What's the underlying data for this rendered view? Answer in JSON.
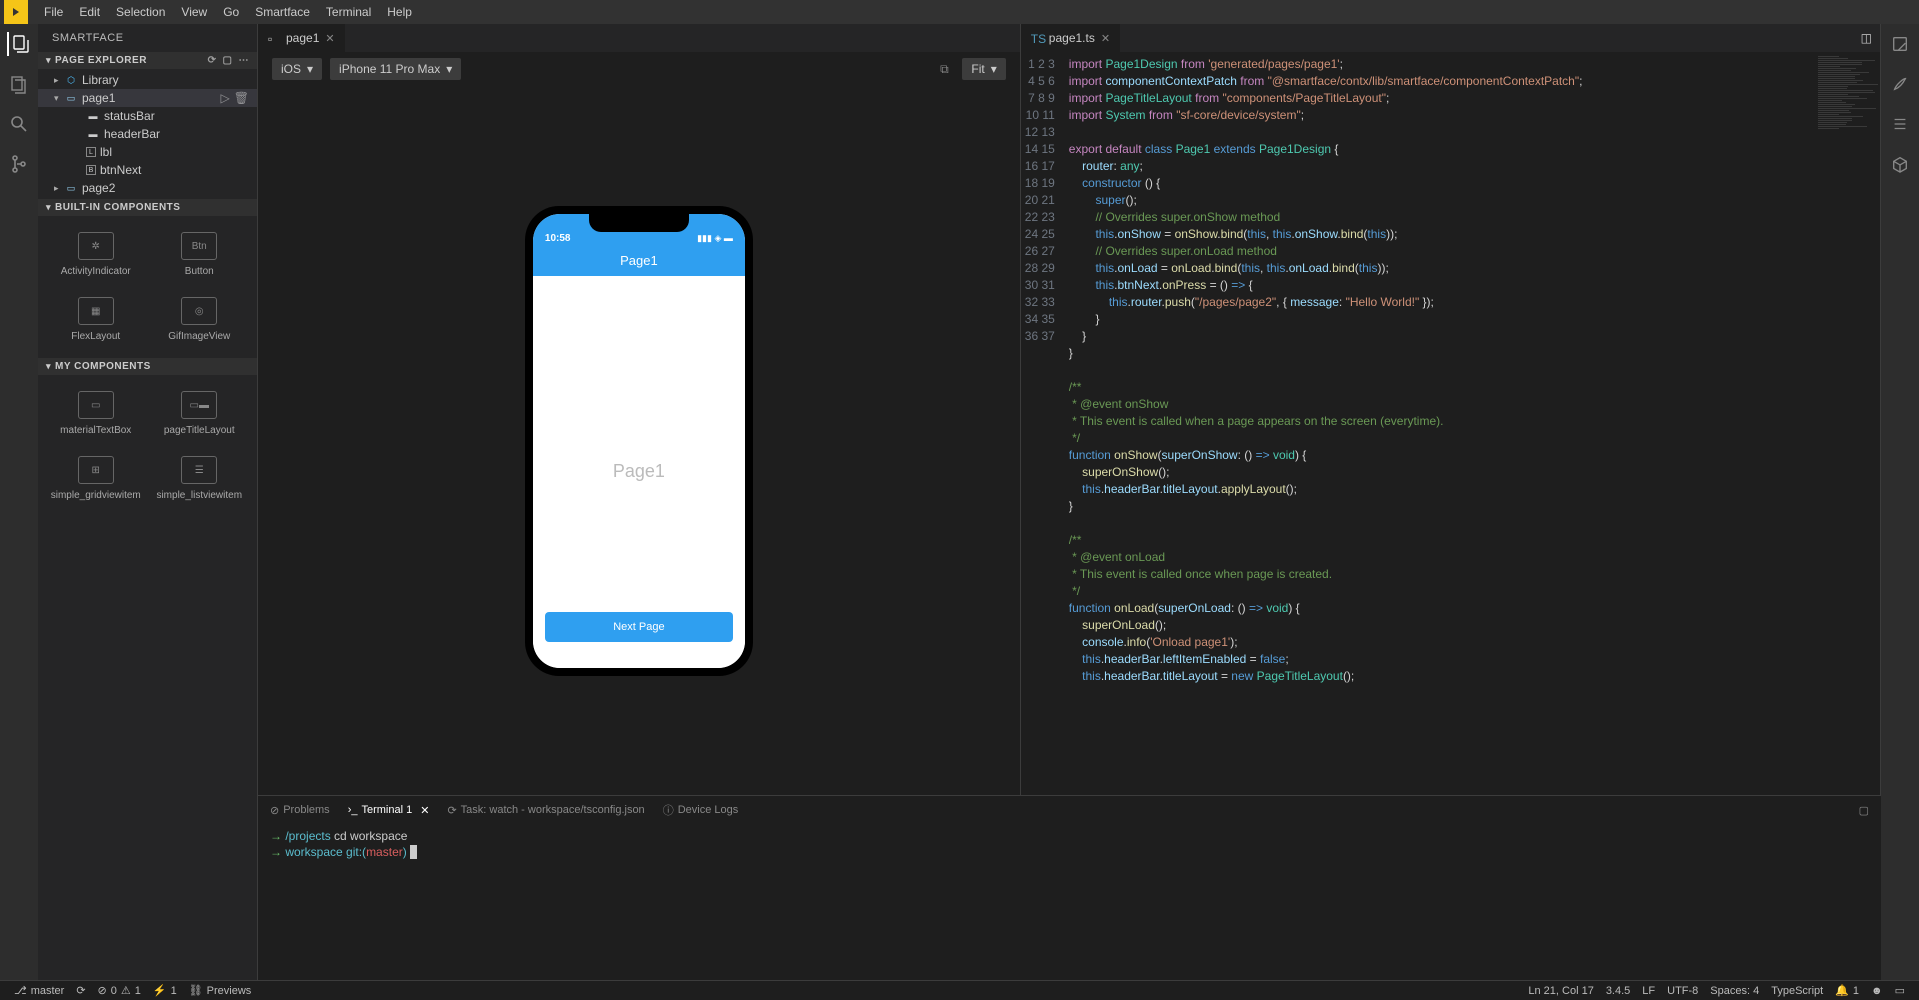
{
  "menu": [
    "File",
    "Edit",
    "Selection",
    "View",
    "Go",
    "Smartface",
    "Terminal",
    "Help"
  ],
  "sidebar_title": "SMARTFACE",
  "section_page_explorer": "PAGE EXPLORER",
  "section_builtin": "BUILT-IN COMPONENTS",
  "section_my": "MY COMPONENTS",
  "tree": {
    "library": "Library",
    "page1": "page1",
    "statusBar": "statusBar",
    "headerBar": "headerBar",
    "lbl": "lbl",
    "btnNext": "btnNext",
    "page2": "page2"
  },
  "builtin": [
    "ActivityIndicator",
    "Button",
    "FlexLayout",
    "GifImageView"
  ],
  "builtin_btn_label": "Btn",
  "my_components": [
    "materialTextBox",
    "pageTitleLayout",
    "simple_gridviewitem",
    "simple_listviewitem"
  ],
  "tabs": {
    "left": "page1",
    "right": "page1.ts"
  },
  "designer": {
    "platform": "iOS",
    "device": "iPhone 11 Pro Max",
    "zoom": "Fit",
    "time": "10:58",
    "header_title": "Page1",
    "body_label": "Page1",
    "btn_label": "Next Page"
  },
  "code_lines": [
    {
      "n": 1,
      "html": "<span class='k-purple'>import</span> <span class='k-teal'>Page1Design</span> <span class='k-purple'>from</span> <span class='k-str'>'generated/pages/page1'</span>;"
    },
    {
      "n": 2,
      "html": "<span class='k-purple'>import</span> <span class='k-lightblue'>componentContextPatch</span> <span class='k-purple'>from</span> <span class='k-str'>\"@smartface/contx/lib/smartface/componentContextPatch\"</span>;"
    },
    {
      "n": 3,
      "html": "<span class='k-purple'>import</span> <span class='k-teal'>PageTitleLayout</span> <span class='k-purple'>from</span> <span class='k-str'>\"components/PageTitleLayout\"</span>;"
    },
    {
      "n": 4,
      "html": "<span class='k-purple'>import</span> <span class='k-teal'>System</span> <span class='k-purple'>from</span> <span class='k-str'>\"sf-core/device/system\"</span>;"
    },
    {
      "n": 5,
      "html": ""
    },
    {
      "n": 6,
      "html": "<span class='k-purple'>export</span> <span class='k-purple'>default</span> <span class='k-blue'>class</span> <span class='k-teal'>Page1</span> <span class='k-blue'>extends</span> <span class='k-teal'>Page1Design</span> {"
    },
    {
      "n": 7,
      "html": "    <span class='k-lightblue'>router</span>: <span class='k-teal'>any</span>;"
    },
    {
      "n": 8,
      "html": "    <span class='k-blue'>constructor</span> () {"
    },
    {
      "n": 9,
      "html": "        <span class='k-blue'>super</span>();"
    },
    {
      "n": 10,
      "html": "        <span class='k-comment'>// Overrides super.onShow method</span>"
    },
    {
      "n": 11,
      "html": "        <span class='k-blue'>this</span>.<span class='k-lightblue'>onShow</span> = <span class='k-yellow'>onShow</span>.<span class='k-yellow'>bind</span>(<span class='k-blue'>this</span>, <span class='k-blue'>this</span>.<span class='k-lightblue'>onShow</span>.<span class='k-yellow'>bind</span>(<span class='k-blue'>this</span>));"
    },
    {
      "n": 12,
      "html": "        <span class='k-comment'>// Overrides super.onLoad method</span>"
    },
    {
      "n": 13,
      "html": "        <span class='k-blue'>this</span>.<span class='k-lightblue'>onLoad</span> = <span class='k-yellow'>onLoad</span>.<span class='k-yellow'>bind</span>(<span class='k-blue'>this</span>, <span class='k-blue'>this</span>.<span class='k-lightblue'>onLoad</span>.<span class='k-yellow'>bind</span>(<span class='k-blue'>this</span>));"
    },
    {
      "n": 14,
      "html": "        <span class='k-blue'>this</span>.<span class='k-lightblue'>btnNext</span>.<span class='k-yellow'>onPress</span> = () <span class='k-blue'>=></span> {"
    },
    {
      "n": 15,
      "html": "            <span class='k-blue'>this</span>.<span class='k-lightblue'>router</span>.<span class='k-yellow'>push</span>(<span class='k-str'>\"/pages/page2\"</span>, { <span class='k-lightblue'>message</span>: <span class='k-str'>\"Hello World!\"</span> });"
    },
    {
      "n": 16,
      "html": "        }"
    },
    {
      "n": 17,
      "html": "    }"
    },
    {
      "n": 18,
      "html": "}"
    },
    {
      "n": 19,
      "html": ""
    },
    {
      "n": 20,
      "html": "<span class='k-comment'>/**</span>"
    },
    {
      "n": 21,
      "html": "<span class='k-comment'> * @event onShow</span>"
    },
    {
      "n": 22,
      "html": "<span class='k-comment'> * This event is called when a page appears on the screen (everytime).</span>"
    },
    {
      "n": 23,
      "html": "<span class='k-comment'> */</span>"
    },
    {
      "n": 24,
      "html": "<span class='k-blue'>function</span> <span class='k-yellow'>onShow</span>(<span class='k-lightblue'>superOnShow</span>: () <span class='k-blue'>=></span> <span class='k-teal'>void</span>) {"
    },
    {
      "n": 25,
      "html": "    <span class='k-yellow'>superOnShow</span>();"
    },
    {
      "n": 26,
      "html": "    <span class='k-blue'>this</span>.<span class='k-lightblue'>headerBar</span>.<span class='k-lightblue'>titleLayout</span>.<span class='k-yellow'>applyLayout</span>();"
    },
    {
      "n": 27,
      "html": "}"
    },
    {
      "n": 28,
      "html": ""
    },
    {
      "n": 29,
      "html": "<span class='k-comment'>/**</span>"
    },
    {
      "n": 30,
      "html": "<span class='k-comment'> * @event onLoad</span>"
    },
    {
      "n": 31,
      "html": "<span class='k-comment'> * This event is called once when page is created.</span>"
    },
    {
      "n": 32,
      "html": "<span class='k-comment'> */</span>"
    },
    {
      "n": 33,
      "html": "<span class='k-blue'>function</span> <span class='k-yellow'>onLoad</span>(<span class='k-lightblue'>superOnLoad</span>: () <span class='k-blue'>=></span> <span class='k-teal'>void</span>) {"
    },
    {
      "n": 34,
      "html": "    <span class='k-yellow'>superOnLoad</span>();"
    },
    {
      "n": 35,
      "html": "    <span class='k-lightblue'>console</span>.<span class='k-yellow'>info</span>(<span class='k-str'>'Onload page1'</span>);"
    },
    {
      "n": 36,
      "html": "    <span class='k-blue'>this</span>.<span class='k-lightblue'>headerBar</span>.<span class='k-lightblue'>leftItemEnabled</span> = <span class='k-blue'>false</span>;"
    },
    {
      "n": 37,
      "html": "    <span class='k-blue'>this</span>.<span class='k-lightblue'>headerBar</span>.<span class='k-lightblue'>titleLayout</span> = <span class='k-blue'>new</span> <span class='k-teal'>PageTitleLayout</span>();"
    }
  ],
  "panel": {
    "problems": "Problems",
    "terminal": "Terminal 1",
    "task": "Task: watch - workspace/tsconfig.json",
    "device_logs": "Device Logs"
  },
  "terminal": {
    "line1_path": "/projects",
    "line1_cmd": "cd workspace",
    "line2_path": "workspace",
    "line2_git": "git:(",
    "line2_branch": "master",
    "line2_close": ")"
  },
  "status": {
    "branch": "master",
    "errors": "0",
    "warnings": "1",
    "ports": "1",
    "previews": "Previews",
    "cursor": "Ln 21, Col 17",
    "version": "3.4.5",
    "eol": "LF",
    "encoding": "UTF-8",
    "spaces": "Spaces: 4",
    "language": "TypeScript",
    "notif": "1"
  }
}
